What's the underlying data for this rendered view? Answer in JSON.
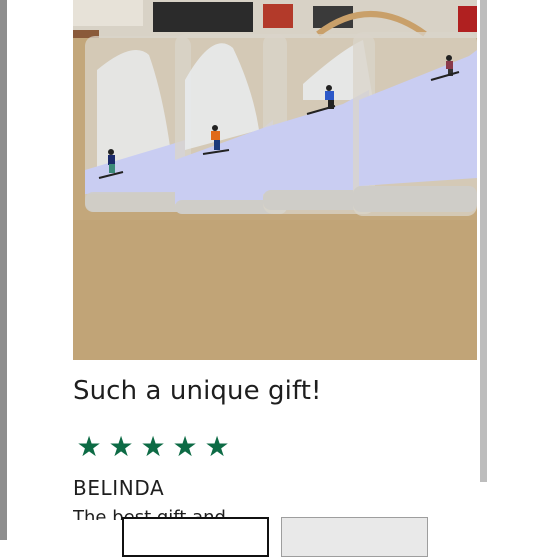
{
  "review": {
    "title": "Such a unique gift!",
    "rating": 5,
    "rating_max": 5,
    "stars": [
      "★",
      "★",
      "★",
      "★",
      "★"
    ],
    "reviewer": "BELINDA",
    "body_partial": "The best gift and"
  },
  "colors": {
    "star": "#0d6b45",
    "text": "#1e1e1e"
  },
  "icons": {
    "star": "star-icon"
  }
}
